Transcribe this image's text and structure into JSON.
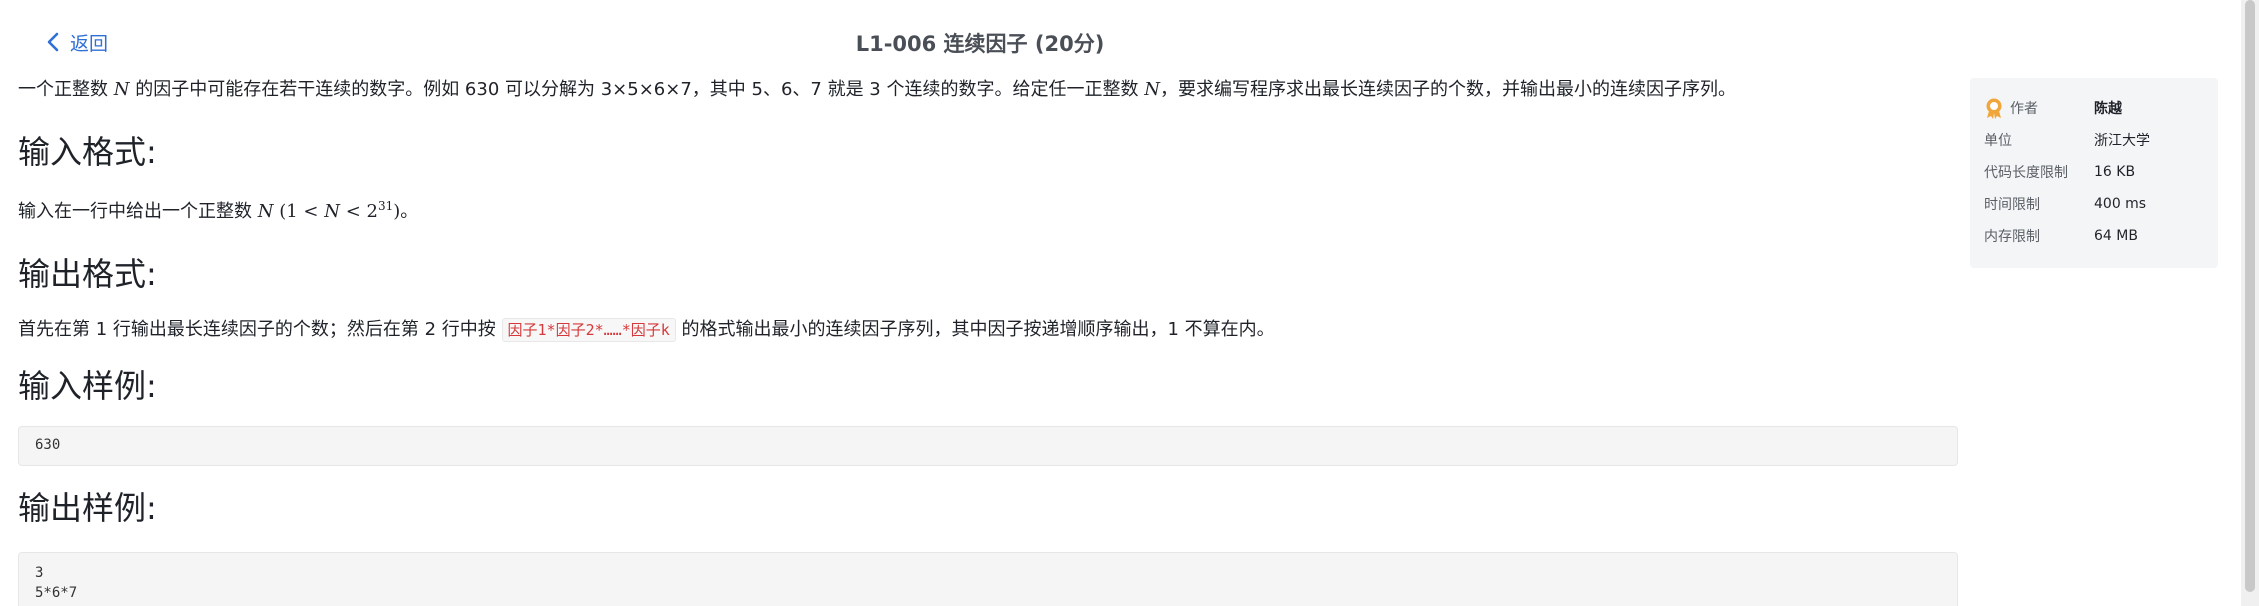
{
  "header": {
    "back_label": "返回",
    "title": "L1-006 连续因子 (20分)"
  },
  "problem": {
    "description_parts": {
      "p1": "一个正整数 ",
      "var_n": "N",
      "p2": " 的因子中可能存在若干连续的数字。例如 630 可以分解为 3×5×6×7，其中 5、6、7 就是 3 个连续的数字。给定任一正整数 ",
      "var_n2": "N",
      "p3": "，要求编写程序求出最长连续因子的个数，并输出最小的连续因子序列。"
    },
    "input_format": {
      "heading": "输入格式:",
      "text_before": "输入在一行中给出一个正整数 ",
      "var_n": "N",
      "math_open": "(1 < ",
      "math_var": "N",
      "math_mid": " < 2",
      "math_exp": "31",
      "math_close": ")",
      "text_after": "。"
    },
    "output_format": {
      "heading": "输出格式:",
      "text_before": "首先在第 1 行输出最长连续因子的个数；然后在第 2 行中按 ",
      "code": "因子1*因子2*……*因子k",
      "text_after": " 的格式输出最小的连续因子序列，其中因子按递增顺序输出，1 不算在内。"
    },
    "sample_input": {
      "heading": "输入样例:",
      "lines": [
        "630"
      ]
    },
    "sample_output": {
      "heading": "输出样例:",
      "lines": [
        "3",
        "5*6*7"
      ]
    }
  },
  "info_panel": {
    "author_label": "作者",
    "author_value": "陈越",
    "unit_label": "单位",
    "unit_value": "浙江大学",
    "code_limit_label": "代码长度限制",
    "code_limit_value": "16 KB",
    "time_limit_label": "时间限制",
    "time_limit_value": "400 ms",
    "mem_limit_label": "内存限制",
    "mem_limit_value": "64 MB"
  },
  "colors": {
    "accent": "#2f6fd6",
    "code_red": "#d6393b",
    "medal": "#f0a63a"
  }
}
